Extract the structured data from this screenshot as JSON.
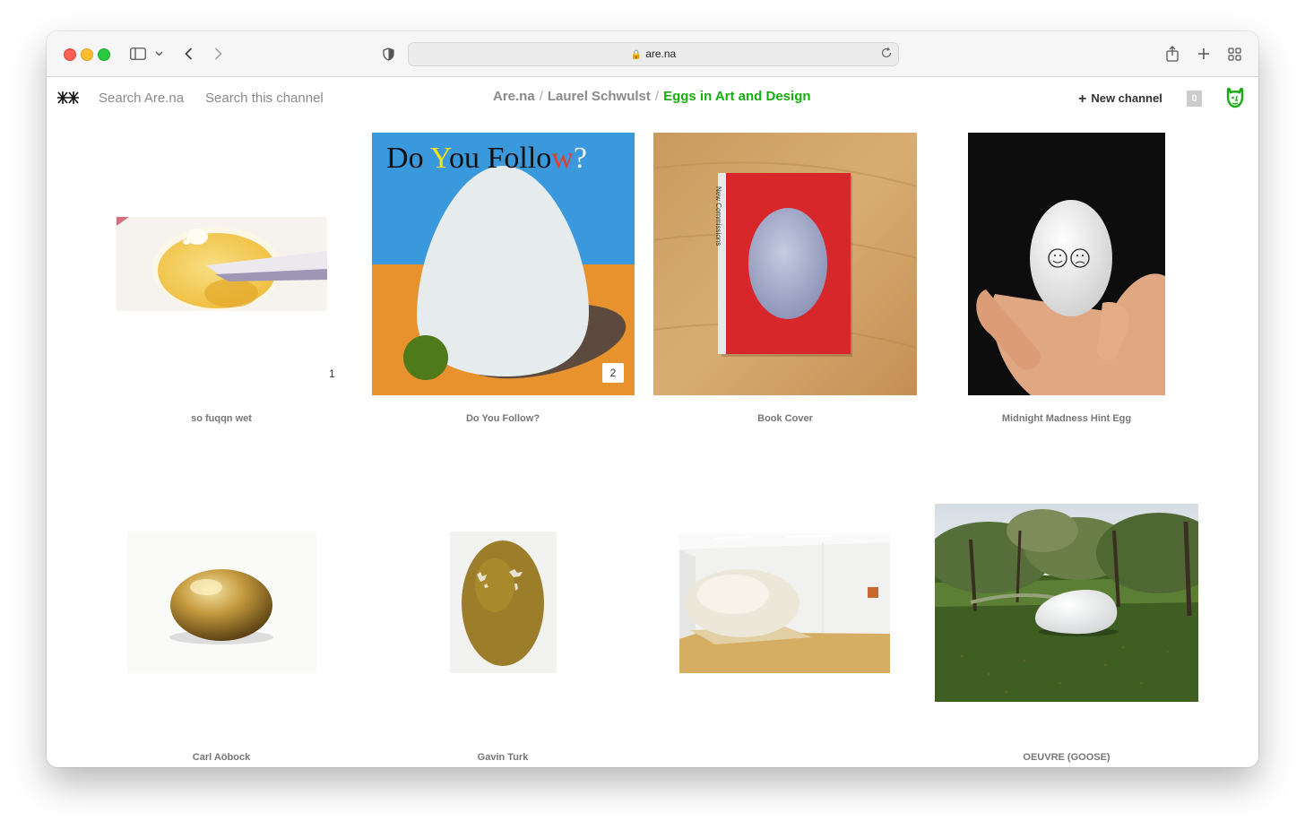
{
  "browser": {
    "url": "are.na"
  },
  "header": {
    "search_arena": "Search Are.na",
    "search_channel": "Search this channel",
    "breadcrumb": [
      "Are.na",
      "Laurel Schwulst",
      "Eggs in Art and Design"
    ],
    "new_channel_label": "New channel",
    "notification_count": "0"
  },
  "blocks": [
    {
      "title": "so fuqqn wet",
      "index": "1"
    },
    {
      "title": "Do You Follow?",
      "index": "2",
      "cover_text": [
        "D",
        "o",
        " ",
        "Y",
        "ou",
        " ",
        "Follo",
        "w",
        "?"
      ]
    },
    {
      "title": "Book Cover",
      "spine_text": "New Commissions"
    },
    {
      "title": "Midnight Madness Hint Egg"
    },
    {
      "title": "Carl Aöbock"
    },
    {
      "title": "Gavin Turk"
    },
    {
      "title": ""
    },
    {
      "title": "OEUVRE (GOOSE)"
    }
  ],
  "colors": {
    "accent_green": "#17ac10",
    "muted_text": "#8a8a8a"
  }
}
